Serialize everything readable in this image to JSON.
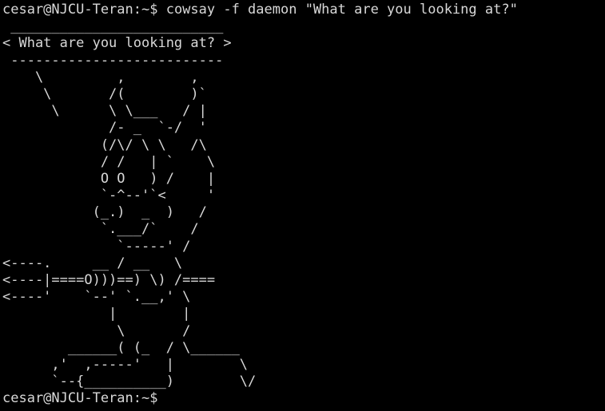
{
  "colors": {
    "background": "#000000",
    "foreground": "#d8d8d8"
  },
  "terminal": {
    "command_prompt": "cesar@NJCU-Teran:~$ ",
    "command": "cowsay -f daemon \"What are you looking at?\"",
    "output_lines": [
      " __________________________",
      "< What are you looking at? >",
      " --------------------------",
      "    \\         ,        ,",
      "     \\       /(        )`",
      "      \\      \\ \\___   / |",
      "             /- _  `-/  '",
      "            (/\\/ \\ \\   /\\",
      "            / /   | `    \\",
      "            O O   ) /    |",
      "            `-^--'`<     '",
      "           (_.)  _  )   /",
      "            `.___/`    /",
      "              `-----' /",
      "<----.     __ / __   \\",
      "<----|====O)))==) \\) /====",
      "<----'    `--' `.__,' \\",
      "             |        |",
      "              \\       /",
      "        ______( (_  / \\______",
      "      ,'  ,-----'   |        \\",
      "      `--{__________)        \\/"
    ],
    "final_prompt": "cesar@NJCU-Teran:~$"
  }
}
